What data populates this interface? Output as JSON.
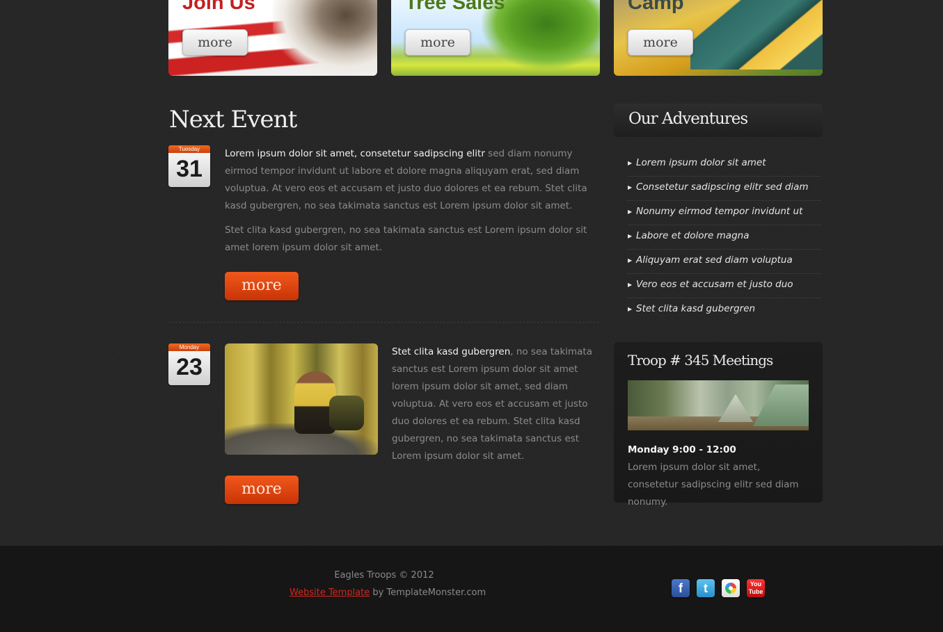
{
  "banners": [
    {
      "title": "Join Us",
      "button": "more"
    },
    {
      "title": "Tree Sales",
      "button": "more"
    },
    {
      "title": "Camp",
      "button": "more"
    }
  ],
  "next_event": {
    "title": "Next Event",
    "events": [
      {
        "weekday": "Tuesday",
        "day": "31",
        "highlight": "Lorem ipsum dolor sit amet, consetetur sadipscing elitr",
        "text": " sed diam nonumy eirmod tempor invidunt ut labore et dolore magna aliquyam erat, sed diam voluptua. At vero eos et accusam et justo duo dolores et ea rebum. Stet clita kasd gubergren, no sea takimata sanctus est Lorem ipsum dolor sit amet.",
        "text2": "Stet clita kasd gubergren, no sea takimata sanctus est Lorem ipsum dolor sit amet lorem ipsum dolor sit amet.",
        "button": "more"
      },
      {
        "weekday": "Monday",
        "day": "23",
        "highlight": "Stet clita kasd gubergren",
        "text": ", no sea takimata sanctus est Lorem ipsum dolor sit amet lorem ipsum dolor sit amet, sed diam voluptua. At vero eos et accusam et justo duo dolores et ea rebum. Stet clita kasd gubergren, no sea takimata sanctus est Lorem ipsum dolor sit amet.",
        "button": "more"
      }
    ]
  },
  "adventures": {
    "title": "Our Adventures",
    "items": [
      "Lorem ipsum dolor sit amet",
      "Consetetur sadipscing elitr sed diam",
      "Nonumy eirmod tempor invidunt ut",
      "Labore et dolore magna",
      "Aliquyam erat sed diam voluptua",
      "Vero eos et accusam et justo duo",
      "Stet clita kasd gubergren"
    ]
  },
  "meetings": {
    "title": "Troop # 345 Meetings",
    "time": "Monday 9:00 - 12:00",
    "desc": "Lorem ipsum dolor sit amet, consetetur sadipscing elitr sed diam nonumy."
  },
  "footer": {
    "copyright": "Eagles Troops © 2012",
    "link": "Website Template",
    "by": " by TemplateMonster.com",
    "social": [
      {
        "name": "facebook-icon",
        "glyph": "f",
        "color": "#3b62b3"
      },
      {
        "name": "twitter-icon",
        "glyph": "t",
        "color": "#3aa8df"
      },
      {
        "name": "picasa-icon",
        "glyph": "",
        "color": "#ffffff"
      },
      {
        "name": "youtube-icon",
        "glyph": "You Tube",
        "color": "#e22"
      }
    ]
  }
}
